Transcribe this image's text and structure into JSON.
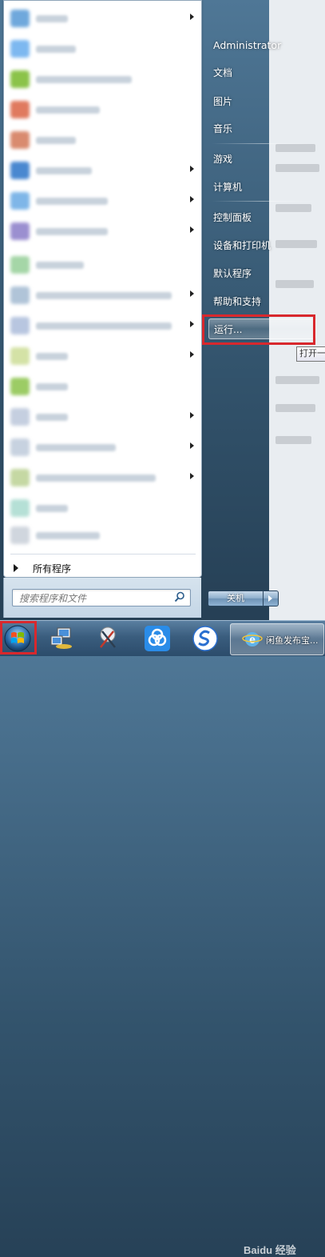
{
  "right_panel": {
    "user": "Administrator",
    "items": [
      "文档",
      "图片",
      "音乐",
      "游戏",
      "计算机",
      "控制面板",
      "设备和打印机",
      "默认程序",
      "帮助和支持",
      "运行..."
    ],
    "run_tooltip": "打开一"
  },
  "left_panel": {
    "all_programs": "所有程序",
    "search_placeholder": "搜索程序和文件"
  },
  "shutdown": {
    "label": "关机"
  },
  "taskbar": {
    "task_label": "闲鱼发布宝...",
    "watermark": "Baidu 经验"
  },
  "colors": {
    "highlight": "#d8282d"
  }
}
